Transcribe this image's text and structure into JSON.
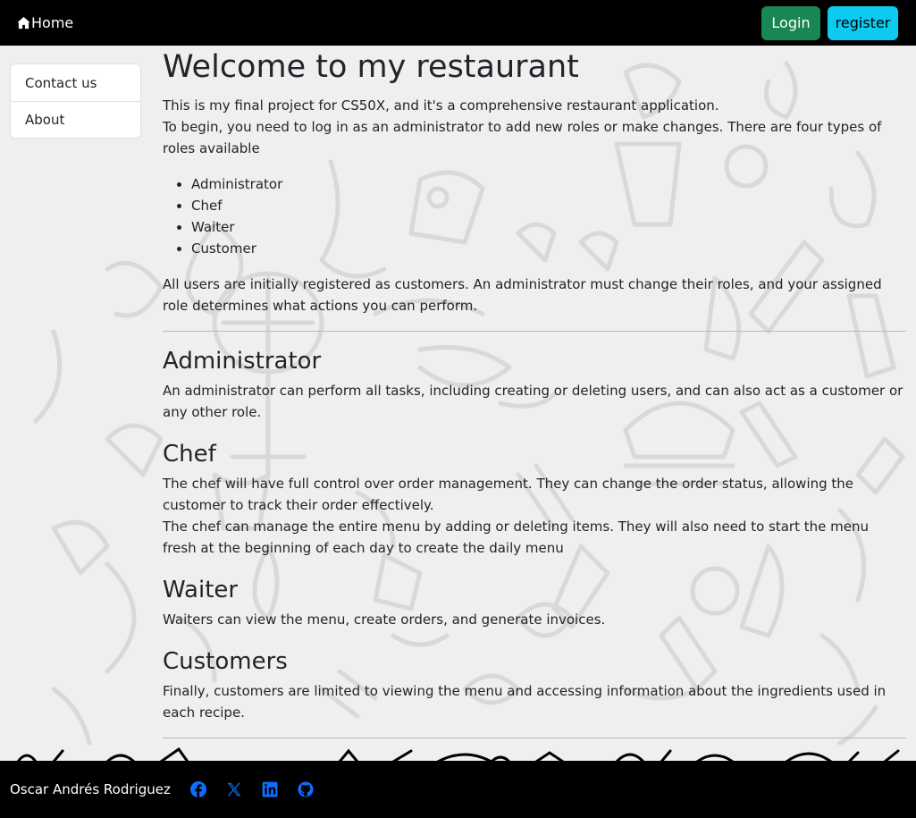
{
  "navbar": {
    "home_label": "Home",
    "login_label": "Login",
    "register_label": "register"
  },
  "sidebar": {
    "items": [
      {
        "label": "Contact us"
      },
      {
        "label": "About"
      }
    ]
  },
  "main": {
    "title": "Welcome to my restaurant",
    "intro_1": "This is my final project for CS50X, and it's a comprehensive restaurant application.",
    "intro_2": "To begin, you need to log in as an administrator to add new roles or make changes. There are four types of roles available",
    "roles": [
      "Administrator",
      "Chef",
      "Waiter",
      "Customer"
    ],
    "intro_3": "All users are initially registered as customers. An administrator must change their roles, and your assigned role determines what actions you can perform.",
    "sections": [
      {
        "heading": "Administrator",
        "paragraphs": [
          "An administrator can perform all tasks, including creating or deleting users, and can also act as a customer or any other role."
        ]
      },
      {
        "heading": "Chef",
        "paragraphs": [
          "The chef will have full control over order management. They can change the order status, allowing the customer to track their order effectively.",
          "The chef can manage the entire menu by adding or deleting items. They will also need to start the menu fresh at the beginning of each day to create the daily menu"
        ]
      },
      {
        "heading": "Waiter",
        "paragraphs": [
          "Waiters can view the menu, create orders, and generate invoices."
        ]
      },
      {
        "heading": "Customers",
        "paragraphs": [
          "Finally, customers are limited to viewing the menu and accessing information about the ingredients used in each recipe."
        ]
      }
    ]
  },
  "footer": {
    "name": "Oscar Andrés Rodriguez",
    "social_icons": [
      "facebook-icon",
      "x-twitter-icon",
      "linkedin-icon",
      "github-icon"
    ],
    "social_color": "#0d6efd"
  },
  "colors": {
    "navbar_bg": "#000000",
    "login_bg": "#198754",
    "register_bg": "#0dcaf0",
    "page_bg": "#efefef"
  }
}
